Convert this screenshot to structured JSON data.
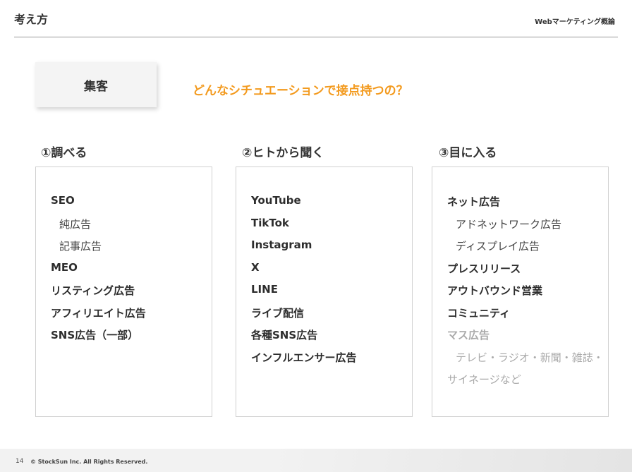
{
  "header": {
    "title": "考え方",
    "subtitle": "Webマーケティング概論"
  },
  "tag": "集客",
  "question": "どんなシチュエーションで接点持つの？",
  "columns": [
    {
      "heading": "①調べる",
      "items": [
        "SEO",
        "純広告",
        "記事広告",
        "MEO",
        "リスティング広告",
        "アフィリエイト広告",
        "SNS広告（一部）"
      ]
    },
    {
      "heading": "②ヒトから聞く",
      "items": [
        "YouTube",
        "TikTok",
        "Instagram",
        "X",
        "LINE",
        "ライブ配信",
        "各種SNS広告",
        "インフルエンサー広告"
      ]
    },
    {
      "heading": "③目に入る",
      "items": [
        "ネット広告",
        "アドネットワーク広告",
        "ディスプレイ広告",
        "プレスリリース",
        "アウトバウンド営業",
        "コミュニティ",
        "マス広告",
        "テレビ・ラジオ・新聞・雑誌・",
        "サイネージなど"
      ]
    }
  ],
  "footer": {
    "page_number": "14",
    "copyright": "© StockSun Inc. All Rights Reserved."
  }
}
